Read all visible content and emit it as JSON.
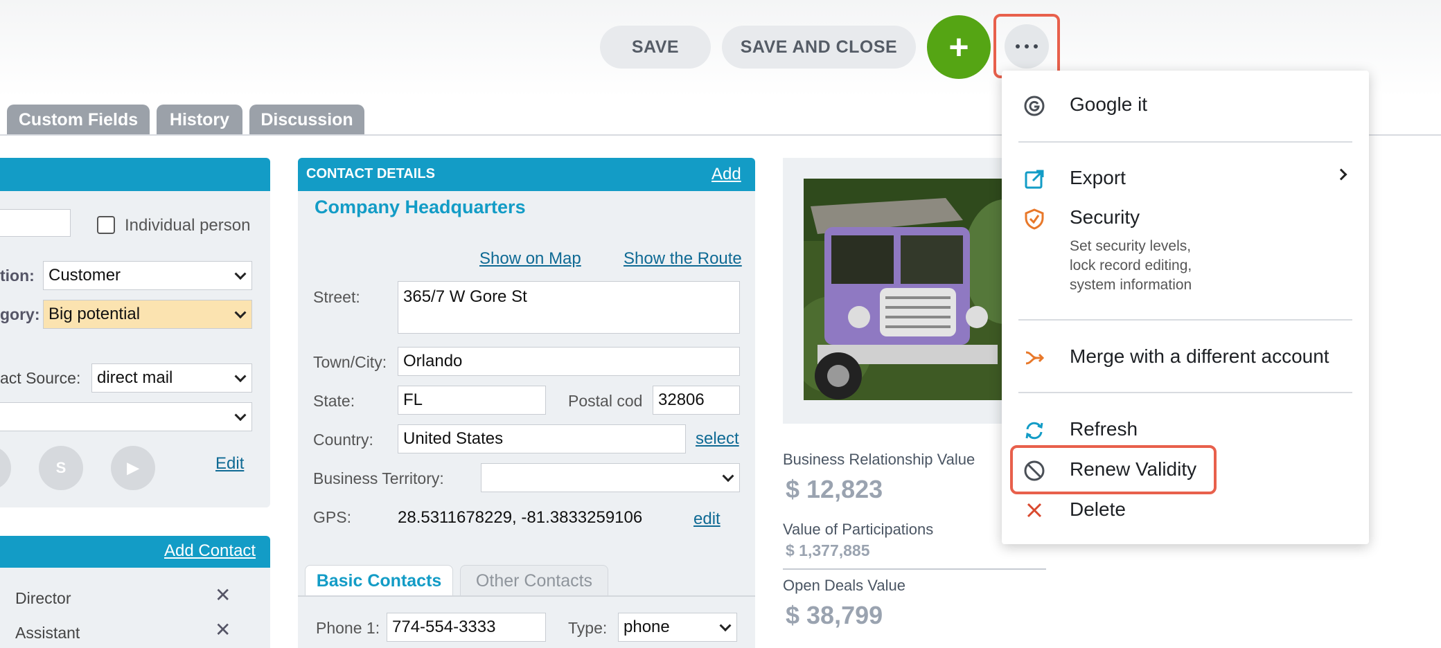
{
  "toolbar": {
    "save_label": "SAVE",
    "save_close_label": "SAVE AND CLOSE",
    "add_icon": "plus-icon",
    "more_icon": "more-horizontal-icon"
  },
  "tabs": [
    {
      "label": "Custom Fields"
    },
    {
      "label": "History"
    },
    {
      "label": "Discussion"
    }
  ],
  "left_panel": {
    "individual_person_label": "Individual person",
    "relation_label": "tion:",
    "relation_value": "Customer",
    "category_label": "gory:",
    "category_value": "Big potential",
    "contact_source_label": "act Source:",
    "contact_source_value": "direct mail",
    "edit_link": "Edit",
    "add_contact_link": "Add Contact",
    "contacts": [
      {
        "role": "Director"
      },
      {
        "role": "Assistant"
      }
    ]
  },
  "contact_details": {
    "header": "CONTACT DETAILS",
    "add_link": "Add",
    "address_title": "Company Headquarters",
    "show_on_map": "Show on Map",
    "show_route": "Show the Route",
    "street_label": "Street:",
    "street_value": "365/7 W Gore St",
    "town_label": "Town/City:",
    "town_value": "Orlando",
    "state_label": "State:",
    "state_value": "FL",
    "postal_label": "Postal cod",
    "postal_value": "32806",
    "country_label": "Country:",
    "country_value": "United States",
    "select_link": "select",
    "territory_label": "Business Territory:",
    "territory_value": "",
    "gps_label": "GPS:",
    "gps_value": "28.5311678229, -81.3833259106",
    "gps_edit": "edit",
    "subtabs": [
      "Basic Contacts",
      "Other Contacts"
    ],
    "phone_label": "Phone 1:",
    "phone_value": "774-554-3333",
    "type_label": "Type:",
    "type_value": "phone"
  },
  "values": {
    "brv_label": "Business Relationship Value",
    "brv_value": "$ 12,823",
    "vop_label": "Value of Participations",
    "vop_value": "$ 1,377,885",
    "odv_label": "Open Deals Value",
    "odv_value": "$ 38,799"
  },
  "menu": {
    "google": "Google it",
    "export": "Export",
    "security": "Security",
    "security_desc_1": "Set security levels,",
    "security_desc_2": "lock record editing,",
    "security_desc_3": "system information",
    "merge": "Merge with a different account",
    "refresh": "Refresh",
    "renew": "Renew Validity",
    "delete": "Delete"
  },
  "colors": {
    "accent": "#139cc6",
    "add_green": "#55a514",
    "highlight": "#e8604c",
    "category_bg": "#fbe3b0"
  }
}
